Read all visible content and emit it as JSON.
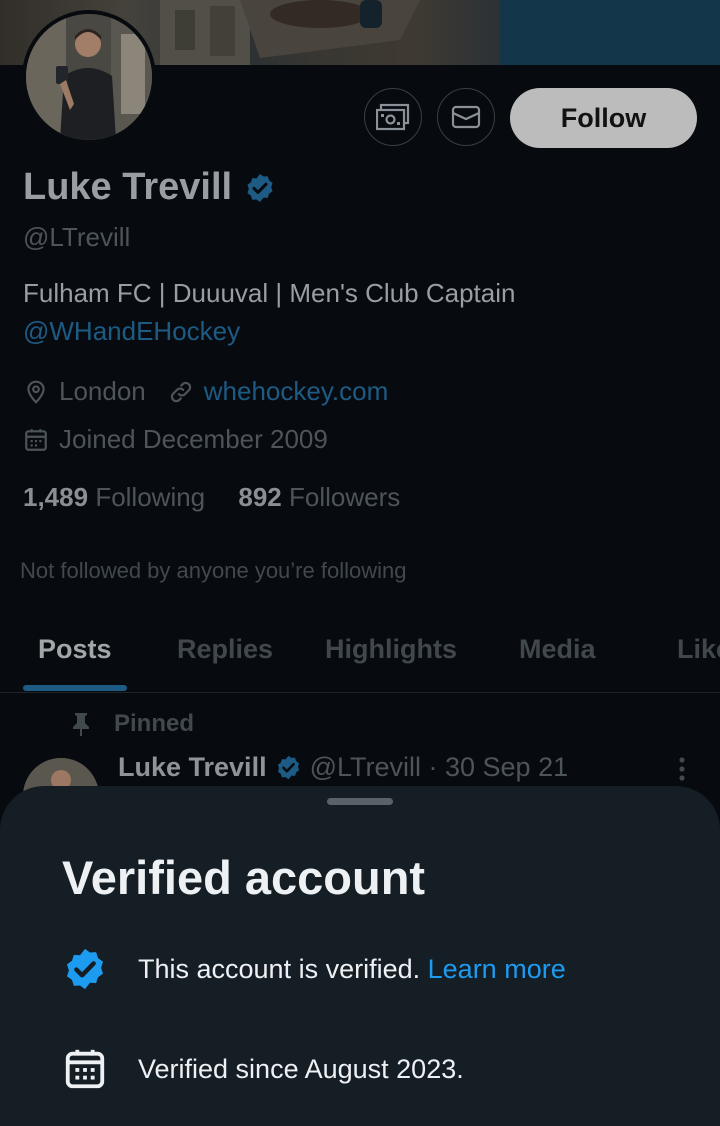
{
  "profile": {
    "name": "Luke Trevill",
    "handle": "@LTrevill",
    "bio_line": "Fulham FC | Duuuval | Men's Club Captain",
    "bio_mention": "@WHandEHockey",
    "location": "London",
    "website": "whehockey.com",
    "joined": "Joined December 2009",
    "following_count": "1,489",
    "following_label": "Following",
    "followers_count": "892",
    "followers_label": "Followers",
    "not_followed": "Not followed by anyone you’re following"
  },
  "actions": {
    "follow_label": "Follow",
    "tip_icon": "money-icon",
    "message_icon": "envelope-icon"
  },
  "tabs": [
    {
      "label": "Posts"
    },
    {
      "label": "Replies"
    },
    {
      "label": "Highlights"
    },
    {
      "label": "Media"
    },
    {
      "label": "Likes"
    }
  ],
  "pinned_post": {
    "pinned_label": "Pinned",
    "author": "Luke Trevill",
    "handle_date": "@LTrevill · 30 Sep 21"
  },
  "sheet": {
    "title": "Verified account",
    "verified_text": "This account is verified.",
    "learn_more": "Learn more",
    "since_text": "Verified since August 2023."
  },
  "colors": {
    "background": "#070b0f",
    "link": "#1d5b84",
    "verified_blue": "#1d9bf0",
    "sheet": "#151d25"
  }
}
